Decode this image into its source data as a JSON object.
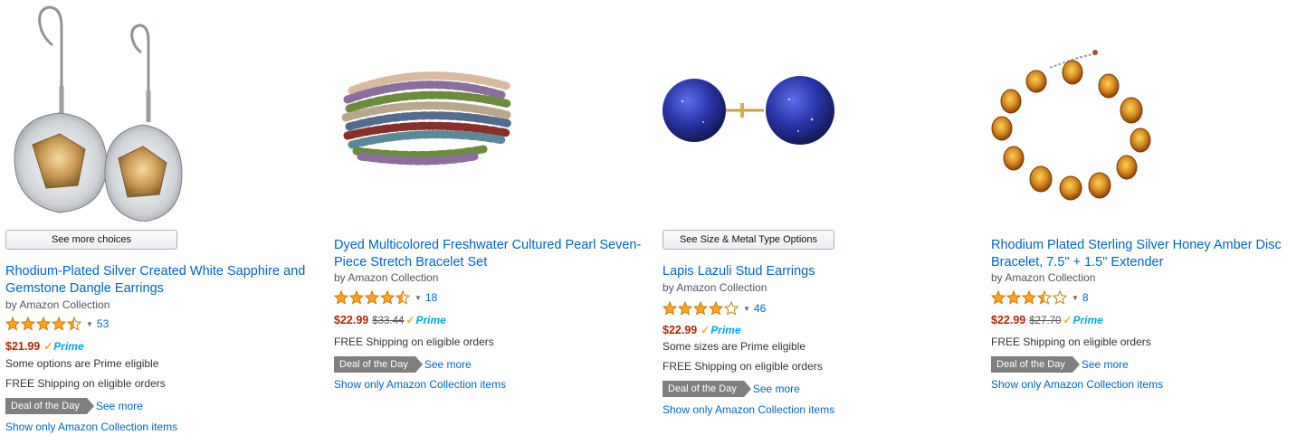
{
  "products": [
    {
      "title": "Rhodium-Plated Silver Created White Sapphire and Gemstone Dangle Earrings",
      "byline": "by Amazon Collection",
      "choices_label": "See more choices",
      "rating": 4.5,
      "reviews": "53",
      "price": "$21.99",
      "list_price": "",
      "prime_label": "Prime",
      "prime_note": "Some options are Prime eligible",
      "shipping": "FREE Shipping on eligible orders",
      "deal_label": "Deal of the Day",
      "see_more": "See more",
      "show_only": "Show only Amazon Collection items",
      "image": "dangle-earrings"
    },
    {
      "title": "Dyed Multicolored Freshwater Cultured Pearl Seven-Piece Stretch Bracelet Set",
      "byline": "by Amazon Collection",
      "rating": 4.5,
      "reviews": "18",
      "price": "$22.99",
      "list_price": "$33.44",
      "prime_label": "Prime",
      "shipping": "FREE Shipping on eligible orders",
      "deal_label": "Deal of the Day",
      "see_more": "See more",
      "show_only": "Show only Amazon Collection items",
      "image": "pearl-bracelets"
    },
    {
      "title": "Lapis Lazuli Stud Earrings",
      "byline": "by Amazon Collection",
      "choices_label": "See Size & Metal Type Options",
      "rating": 4,
      "reviews": "46",
      "price": "$22.99",
      "list_price": "",
      "prime_label": "Prime",
      "prime_note": "Some sizes are Prime eligible",
      "shipping": "FREE Shipping on eligible orders",
      "deal_label": "Deal of the Day",
      "see_more": "See more",
      "show_only": "Show only Amazon Collection items",
      "image": "lapis-studs"
    },
    {
      "title": "Rhodium Plated Sterling Silver Honey Amber Disc Bracelet, 7.5\" + 1.5\" Extender",
      "byline": "by Amazon Collection",
      "rating": 3.5,
      "reviews": "8",
      "price": "$22.99",
      "list_price": "$27.70",
      "prime_label": "Prime",
      "shipping": "FREE Shipping on eligible orders",
      "deal_label": "Deal of the Day",
      "see_more": "See more",
      "show_only": "Show only Amazon Collection items",
      "image": "amber-bracelet"
    }
  ],
  "colors": {
    "link": "#0066c0",
    "price": "#b12704",
    "star": "#ffa41c",
    "prime": "#00a8e1",
    "deal": "#7f7f7f"
  }
}
